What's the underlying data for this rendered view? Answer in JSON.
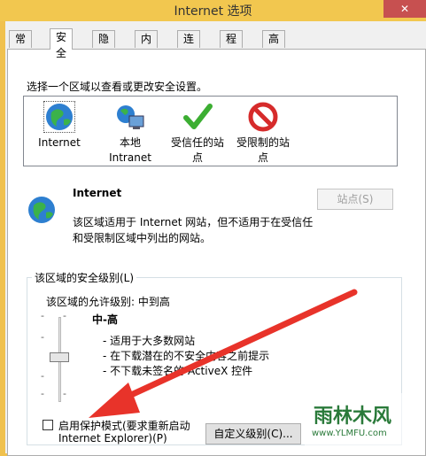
{
  "window": {
    "title": "Internet 选项",
    "close_symbol": "✕"
  },
  "tabs": [
    {
      "label": "常规"
    },
    {
      "label": "安全"
    },
    {
      "label": "隐私"
    },
    {
      "label": "内容"
    },
    {
      "label": "连接"
    },
    {
      "label": "程序"
    },
    {
      "label": "高级"
    }
  ],
  "active_tab": "安全",
  "security": {
    "instruction": "选择一个区域以查看或更改安全设置。",
    "zones": [
      {
        "label": "Internet",
        "icon": "globe-icon"
      },
      {
        "label": "本地\nIntranet",
        "icon": "intranet-icon"
      },
      {
        "label": "受信任的站\n点",
        "icon": "checkmark-icon"
      },
      {
        "label": "受限制的站\n点",
        "icon": "no-entry-icon"
      }
    ],
    "selected_zone": {
      "name": "Internet",
      "description_line1": "该区域适用于 Internet 网站，但不适用于在受信任",
      "description_line2": "和受限制区域中列出的网站。"
    },
    "sites_button": "站点(S)",
    "level_group_label": "该区域的安全级别(L)",
    "allowed_levels": "该区域的允许级别: 中到高",
    "current_level": "中-高",
    "level_bullets": [
      "- 适用于大多数网站",
      "- 在下载潜在的不安全内容之前提示",
      "- 不下载未签名的 ActiveX 控件"
    ],
    "protected_mode_line1": "启用保护模式(要求重新启动",
    "protected_mode_line2": "Internet Explorer)(P)",
    "custom_level_button": "自定义级别(C)...",
    "protected_mode_checked": false
  },
  "watermark": {
    "brand": "雨林木风",
    "url": "www.YLMFU.com"
  },
  "colors": {
    "titlebar": "#f2c74f",
    "close": "#c75050",
    "arrow": "#e8332a"
  }
}
